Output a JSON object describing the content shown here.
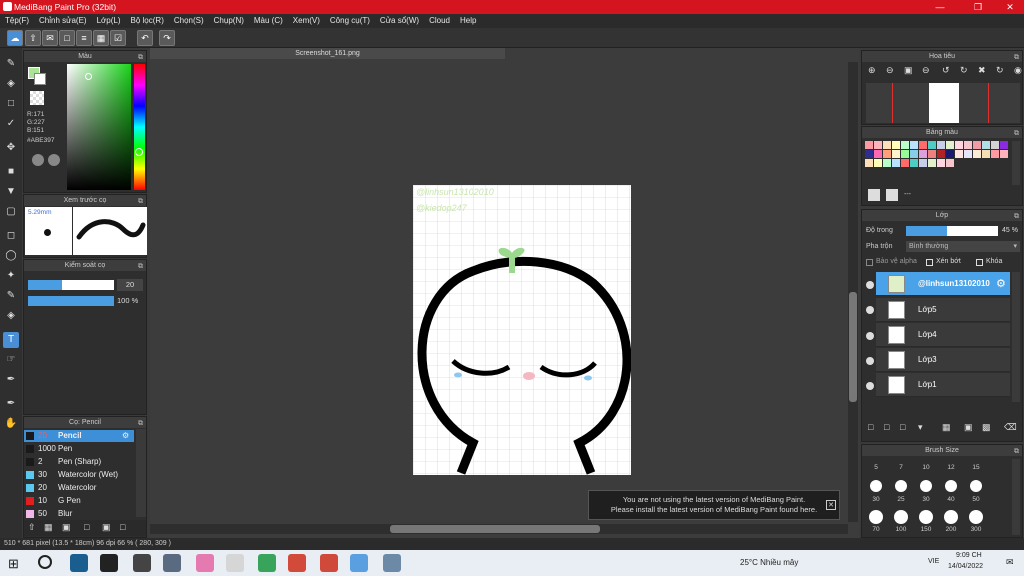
{
  "titlebar": {
    "title": "MediBang Paint Pro (32bit)"
  },
  "menu": [
    "Tệp(F)",
    "Chỉnh sửa(E)",
    "Lớp(L)",
    "Bộ lọc(R)",
    "Chọn(S)",
    "Chụp(N)",
    "Màu (C)",
    "Xem(V)",
    "Công cụ(T)",
    "Cửa sổ(W)",
    "Cloud",
    "Help"
  ],
  "panels": {
    "color": {
      "title": "Màu",
      "r": "R:171",
      "g": "G:227",
      "b": "B:151",
      "hex": "#ABE397"
    },
    "brush_preview": {
      "title": "Xem trước cọ",
      "size": "5.29mm"
    },
    "brush_control": {
      "title": "Kiểm soát cọ",
      "size_value": "20",
      "opacity_value": "100 %"
    },
    "brush_list": {
      "title": "Cọ: Pencil",
      "items": [
        {
          "size": "20",
          "name": "Pencil",
          "color": "#1a1a1a",
          "selected": true
        },
        {
          "size": "1000",
          "name": "Pen",
          "color": "#1a1a1a"
        },
        {
          "size": "2",
          "name": "Pen (Sharp)",
          "color": "#1a1a1a"
        },
        {
          "size": "30",
          "name": "Watercolor (Wet)",
          "color": "#5bc8ef"
        },
        {
          "size": "20",
          "name": "Watercolor",
          "color": "#5bc8ef"
        },
        {
          "size": "10",
          "name": "G Pen",
          "color": "#e02020"
        },
        {
          "size": "50",
          "name": "Blur",
          "color": "#f0b8e8"
        }
      ]
    },
    "navigator": {
      "title": "Hoa tiêu"
    },
    "palette": {
      "title": "Bảng màu",
      "extra": "---"
    },
    "layer": {
      "title": "Lớp",
      "opacity_label": "Độ trong",
      "opacity_value": "45 %",
      "opacity_pct": 45,
      "blend_label": "Pha trộn",
      "blend_value": "Bình thường",
      "protect_alpha": "Bảo vệ alpha",
      "clipping": "Xén bớt",
      "lock": "Khóa",
      "layers": [
        {
          "name": "@linhsun13102010",
          "selected": true
        },
        {
          "name": "Lớp5"
        },
        {
          "name": "Lớp4"
        },
        {
          "name": "Lớp3"
        },
        {
          "name": "Lớp1"
        }
      ]
    },
    "brush_size": {
      "title": "Brush Size",
      "row0": [
        "5",
        "7",
        "10",
        "12",
        "15"
      ],
      "row1": [
        "30",
        "25",
        "30",
        "40",
        "50"
      ],
      "row2": [
        "70",
        "100",
        "150",
        "200",
        "300"
      ]
    }
  },
  "document": {
    "tab": "Screenshot_161.png",
    "watermark1": "@linhsun13102010",
    "watermark2": "@kiedop247"
  },
  "notification": {
    "line1": "You are not using the latest version of MediBang Paint.",
    "line2": "Please install the latest version of MediBang Paint found here."
  },
  "status": {
    "text": "510 * 681 pixel   (13.5 * 18cm)   96 dpi   66 %   ( 280, 309 )"
  },
  "taskbar": {
    "weather": "25°C  Nhiều mây",
    "lang": "VIE",
    "time": "9:09 CH",
    "date": "14/04/2022"
  }
}
